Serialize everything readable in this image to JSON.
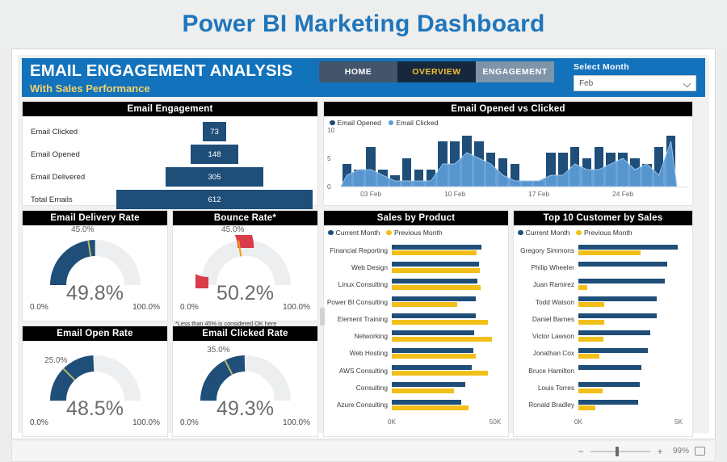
{
  "page_title": "Power BI Marketing Dashboard",
  "accent_color": "#1f76bc",
  "header": {
    "title": "EMAIL ENGAGEMENT ANALYSIS",
    "subtitle": "With Sales Performance",
    "nav": [
      {
        "label": "HOME",
        "active": false
      },
      {
        "label": "OVERVIEW",
        "active": true
      },
      {
        "label": "ENGAGEMENT",
        "active": false
      }
    ],
    "month_label": "Select Month",
    "month_value": "Feb"
  },
  "funnel": {
    "title": "Email Engagement",
    "rows": [
      {
        "label": "Email Clicked",
        "value": "73"
      },
      {
        "label": "Email Opened",
        "value": "148"
      },
      {
        "label": "Email Delivered",
        "value": "305"
      },
      {
        "label": "Total Emails",
        "value": "612"
      }
    ]
  },
  "combo": {
    "title": "Email Opened vs Clicked",
    "legend": [
      {
        "label": "Email Opened",
        "color": "#1f4e79"
      },
      {
        "label": "Email Clicked",
        "color": "#5b9bd5"
      }
    ]
  },
  "gauges": [
    {
      "title": "Email Delivery Rate",
      "value": "49.8%",
      "target": "45.0%",
      "min": "0.0%",
      "max": "100.0%",
      "color": "#1f4e79",
      "note": ""
    },
    {
      "title": "Bounce Rate*",
      "value": "50.2%",
      "target": "45.0%",
      "min": "0.0%",
      "max": "100.0%",
      "color": "#d93c4a",
      "note": "*Less than 45% is considered OK here"
    },
    {
      "title": "Email Open Rate",
      "value": "48.5%",
      "target": "25.0%",
      "min": "0.0%",
      "max": "100.0%",
      "color": "#1f4e79",
      "note": ""
    },
    {
      "title": "Email Clicked Rate",
      "value": "49.3%",
      "target": "35.0%",
      "min": "0.0%",
      "max": "100.0%",
      "color": "#1f4e79",
      "note": ""
    }
  ],
  "sales": {
    "title": "Sales by Product",
    "legend": [
      {
        "label": "Current Month",
        "color": "#1f4e79"
      },
      {
        "label": "Previous Month",
        "color": "#f2bf18"
      }
    ]
  },
  "customers": {
    "title": "Top 10 Customer by Sales",
    "legend": [
      {
        "label": "Current Month",
        "color": "#1f4e79"
      },
      {
        "label": "Previous Month",
        "color": "#f2bf18"
      }
    ]
  },
  "statusbar": {
    "zoom_out": "−",
    "zoom_in": "+",
    "zoom_percent": "99%",
    "fit_icon": "fit-to-page-icon"
  },
  "chart_data": [
    {
      "type": "bar",
      "title": "Email Engagement",
      "subtype": "funnel",
      "categories": [
        "Email Clicked",
        "Email Opened",
        "Email Delivered",
        "Total Emails"
      ],
      "values": [
        73,
        148,
        305,
        612
      ],
      "xlabel": "",
      "ylabel": "",
      "grid": false,
      "legend": "none"
    },
    {
      "type": "line",
      "title": "Email Opened vs Clicked",
      "subtype": "column-plus-area",
      "xlabel": "",
      "ylabel": "",
      "ylim": [
        0,
        10
      ],
      "yticks": [
        0,
        5,
        10
      ],
      "xtick_labels": [
        "03 Feb",
        "10 Feb",
        "17 Feb",
        "24 Feb"
      ],
      "xtick_positions": [
        3,
        10,
        17,
        24
      ],
      "grid": false,
      "legend": "top-left",
      "x": [
        1,
        2,
        3,
        4,
        5,
        6,
        7,
        8,
        9,
        10,
        11,
        12,
        13,
        14,
        15,
        16,
        17,
        18,
        19,
        20,
        21,
        22,
        23,
        24,
        25,
        26,
        27,
        28
      ],
      "series": [
        {
          "name": "Email Opened",
          "color": "#1f4e79",
          "type": "column",
          "values": [
            4,
            3,
            7,
            3,
            2,
            5,
            3,
            3,
            8,
            8,
            9,
            8,
            6,
            5,
            4,
            1,
            1,
            6,
            6,
            7,
            5,
            7,
            6,
            6,
            5,
            4,
            7,
            9
          ]
        },
        {
          "name": "Email Clicked",
          "color": "#5b9bd5",
          "type": "area",
          "values": [
            2,
            3,
            3,
            2,
            1,
            1,
            1,
            1,
            4,
            4,
            6,
            5,
            4,
            2,
            1,
            1,
            1,
            2,
            2,
            4,
            3,
            3,
            4,
            5,
            3,
            4,
            2,
            8
          ]
        }
      ]
    },
    {
      "type": "bar",
      "title": "Email Delivery Rate",
      "subtype": "gauge",
      "value": 49.8,
      "target": 45.0,
      "min": 0.0,
      "max": 100.0,
      "value_label": "49.8%",
      "target_label": "45.0%",
      "min_label": "0.0%",
      "max_label": "100.0%",
      "color": "#1f4e79"
    },
    {
      "type": "bar",
      "title": "Bounce Rate*",
      "subtype": "gauge",
      "value": 50.2,
      "target": 45.0,
      "min": 0.0,
      "max": 100.0,
      "value_label": "50.2%",
      "target_label": "45.0%",
      "min_label": "0.0%",
      "max_label": "100.0%",
      "color": "#d93c4a",
      "annotation": "*Less than 45% is considered OK here"
    },
    {
      "type": "bar",
      "title": "Email Open Rate",
      "subtype": "gauge",
      "value": 48.5,
      "target": 25.0,
      "min": 0.0,
      "max": 100.0,
      "value_label": "48.5%",
      "target_label": "25.0%",
      "min_label": "0.0%",
      "max_label": "100.0%",
      "color": "#1f4e79"
    },
    {
      "type": "bar",
      "title": "Email Clicked Rate",
      "subtype": "gauge",
      "value": 49.3,
      "target": 35.0,
      "min": 0.0,
      "max": 100.0,
      "value_label": "49.3%",
      "target_label": "35.0%",
      "min_label": "0.0%",
      "max_label": "100.0%",
      "color": "#1f4e79"
    },
    {
      "type": "bar",
      "title": "Sales by Product",
      "subtype": "horizontal-grouped",
      "orientation": "horizontal",
      "xlabel": "",
      "ylabel": "",
      "xlim": [
        0,
        50000
      ],
      "xtick_labels": [
        "0K",
        "50K"
      ],
      "xtick_values": [
        0,
        50000
      ],
      "grid": false,
      "legend": "top-left",
      "categories": [
        "Financial Reporting",
        "Web Design",
        "Linux Consulting",
        "Power BI Consulting",
        "Element Training",
        "Networking",
        "Web Hosting",
        "AWS Consulting",
        "Consulting",
        "Azure Consulting"
      ],
      "series": [
        {
          "name": "Current Month",
          "color": "#1f4e79",
          "values": [
            43500,
            42000,
            41500,
            40500,
            40500,
            40000,
            39500,
            38500,
            35500,
            33500
          ]
        },
        {
          "name": "Previous Month",
          "color": "#f2bf18",
          "values": [
            41000,
            42500,
            43000,
            31500,
            46500,
            48500,
            40500,
            46500,
            30000,
            37000
          ]
        }
      ]
    },
    {
      "type": "bar",
      "title": "Top 10 Customer by Sales",
      "subtype": "horizontal-grouped",
      "orientation": "horizontal",
      "xlabel": "",
      "ylabel": "",
      "xlim": [
        0,
        5000
      ],
      "xtick_labels": [
        "0K",
        "5K"
      ],
      "xtick_values": [
        0,
        5000
      ],
      "grid": false,
      "legend": "top-left",
      "categories": [
        "Gregory Simmons",
        "Philip Wheeler",
        "Juan Ramirez",
        "Todd Watson",
        "Daniel Barnes",
        "Victor Lawson",
        "Jonathan Cox",
        "Bruce Hamilton",
        "Louis Torres",
        "Ronald Bradley"
      ],
      "series": [
        {
          "name": "Current Month",
          "color": "#1f4e79",
          "values": [
            4950,
            4450,
            4300,
            3900,
            3900,
            3600,
            3450,
            3150,
            3050,
            3000
          ]
        },
        {
          "name": "Previous Month",
          "color": "#f2bf18",
          "values": [
            3100,
            0,
            450,
            1300,
            1300,
            1250,
            1050,
            0,
            1200,
            850
          ]
        }
      ]
    }
  ]
}
